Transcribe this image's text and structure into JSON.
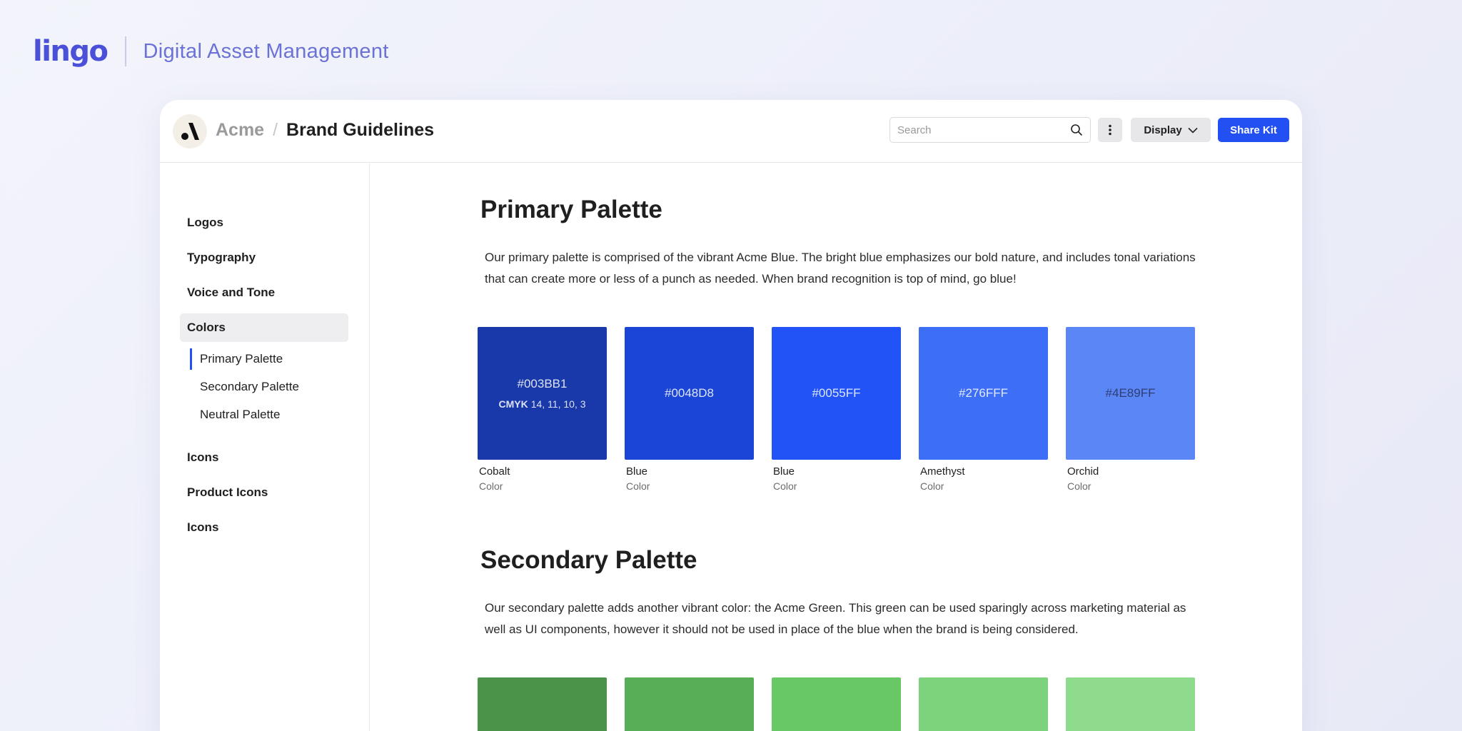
{
  "brand": {
    "logo_text": "lingo",
    "subtitle": "Digital Asset Management"
  },
  "header": {
    "breadcrumb_root": "Acme",
    "breadcrumb_separator": "/",
    "breadcrumb_current": "Brand Guidelines",
    "search_placeholder": "Search",
    "display_label": "Display",
    "share_label": "Share Kit"
  },
  "sidebar": {
    "items": [
      {
        "label": "Logos"
      },
      {
        "label": "Typography"
      },
      {
        "label": "Voice and Tone"
      },
      {
        "label": "Colors",
        "active": true
      },
      {
        "label": "Icons"
      },
      {
        "label": "Product Icons"
      },
      {
        "label": "Icons"
      }
    ],
    "sub_items": [
      {
        "label": "Primary Palette",
        "current": true
      },
      {
        "label": "Secondary Palette"
      },
      {
        "label": "Neutral Palette"
      }
    ]
  },
  "primary": {
    "title": "Primary Palette",
    "description": "Our primary palette is comprised of the vibrant Acme Blue. The bright blue emphasizes our bold nature, and includes tonal variations that can create more or less of a punch as needed. When brand recognition is top of mind, go blue!",
    "swatches": [
      {
        "hex": "#003BB1",
        "cmyk_label": "CMYK",
        "cmyk": "14, 11, 10, 3",
        "name": "Cobalt",
        "type": "Color",
        "color": "#1939ab"
      },
      {
        "hex": "#0048D8",
        "name": "Blue",
        "type": "Color",
        "color": "#1b45d6"
      },
      {
        "hex": "#0055FF",
        "name": "Blue",
        "type": "Color",
        "color": "#2153f7"
      },
      {
        "hex": "#276FFF",
        "name": "Amethyst",
        "type": "Color",
        "color": "#3c6ef6"
      },
      {
        "hex": "#4E89FF",
        "name": "Orchid",
        "type": "Color",
        "color": "#5a87f5"
      }
    ]
  },
  "secondary": {
    "title": "Secondary Palette",
    "description": "Our secondary palette adds another vibrant color: the Acme Green. This green can be used sparingly across marketing material as well as UI components, however it should not be used in place of the blue when the brand is being considered.",
    "swatch_colors": [
      "#4a9349",
      "#58ad57",
      "#68c865",
      "#7dd37b",
      "#8fdb8e"
    ]
  },
  "colors": {
    "accent": "#2250f2",
    "brand": "#4a50d8"
  }
}
